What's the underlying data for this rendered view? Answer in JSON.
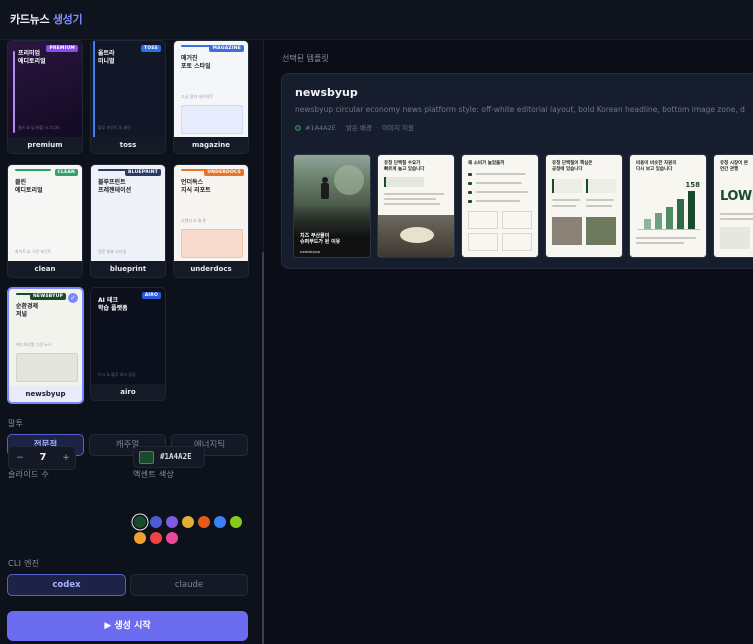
{
  "app": {
    "title_prefix": "카드뉴스",
    "title_accent": "생성기"
  },
  "templates": [
    {
      "id": "premium",
      "name": "premium",
      "badge": "PREMIUM",
      "title": "프리미엄\n에디토리얼",
      "sub": "골드 & 딥 퍼플 시그니처"
    },
    {
      "id": "toss",
      "name": "toss",
      "badge": "TOSS",
      "title": "울트라\n미니멀",
      "sub": "블루 포인트 & 클린"
    },
    {
      "id": "magazine",
      "name": "magazine",
      "badge": "MAGAZINE",
      "title": "매거진\n포토 스타일",
      "sub": "고급 잡지 레이아웃"
    },
    {
      "id": "clean",
      "name": "clean",
      "badge": "CLEAN",
      "title": "클린\n에디토리얼",
      "sub": "화이트 & 그린 포인트"
    },
    {
      "id": "blueprint",
      "name": "blueprint",
      "badge": "BLUEPRINT",
      "title": "블루프린트\n프레젠테이션",
      "sub": "전문 발표 스타일"
    },
    {
      "id": "underdocs",
      "name": "underdocs",
      "badge": "UNDERDOCS",
      "title": "언더독스\n지식 리포트",
      "sub": "오렌지 & 웜 톤"
    },
    {
      "id": "newsbyup",
      "name": "newsbyup",
      "badge": "NEWSBYUP",
      "title": "순환경제\n저널",
      "sub": "에디토리얼 그린 뉴스"
    },
    {
      "id": "airo",
      "name": "airo",
      "badge": "AIRO",
      "title": "AI 테크\n학습 플랫폼",
      "sub": "다크 & 블루 테크 감성"
    }
  ],
  "tone": {
    "label": "말투",
    "options": [
      "전문적",
      "캐주얼",
      "에너지틱"
    ],
    "selected": "전문적"
  },
  "slides": {
    "label": "슬라이드 수",
    "minus": "−",
    "value": "7",
    "plus": "+"
  },
  "accent": {
    "label": "액센트 색상",
    "value": "#1A4A2E",
    "swatches": [
      "#1A4A2E",
      "#4f5bd5",
      "#7c5ce0",
      "#e0b030",
      "#e65a1a",
      "#3b82f6",
      "#84cc16",
      "#f0a030",
      "#ef4444",
      "#ec4899"
    ]
  },
  "cli": {
    "label": "CLI 엔진",
    "options": [
      "codex",
      "claude"
    ],
    "selected": "codex"
  },
  "generate": {
    "label": "▶ 생성 시작"
  },
  "main": {
    "selected_label": "선택된 템플릿",
    "name": "newsbyup",
    "description": "newsbyup circular economy news platform style: off-white editorial layout, bold Korean headline, bottom image zone, d",
    "meta_color": "#1A4A2E",
    "meta_bg": "밝은 배경",
    "meta_img": "이미지 지원",
    "thumbs": [
      {
        "caption": "치즈 부산물이\n슈퍼푸드가 된 이유",
        "footer": "newsbyup"
      },
      {
        "title": "유청 단백질 수요가\n빠르게 늘고 있습니다"
      },
      {
        "title": "왜 소비가 늘었을까"
      },
      {
        "title": "유청 단백질이 핵심은\n공정에 있습니다"
      },
      {
        "title": "비용이 비슷한 자원의\n다시 보고 있습니다",
        "big": "158"
      },
      {
        "title": "유청 시장이 본\n연간 관행",
        "big_text": "LOWE"
      }
    ]
  }
}
